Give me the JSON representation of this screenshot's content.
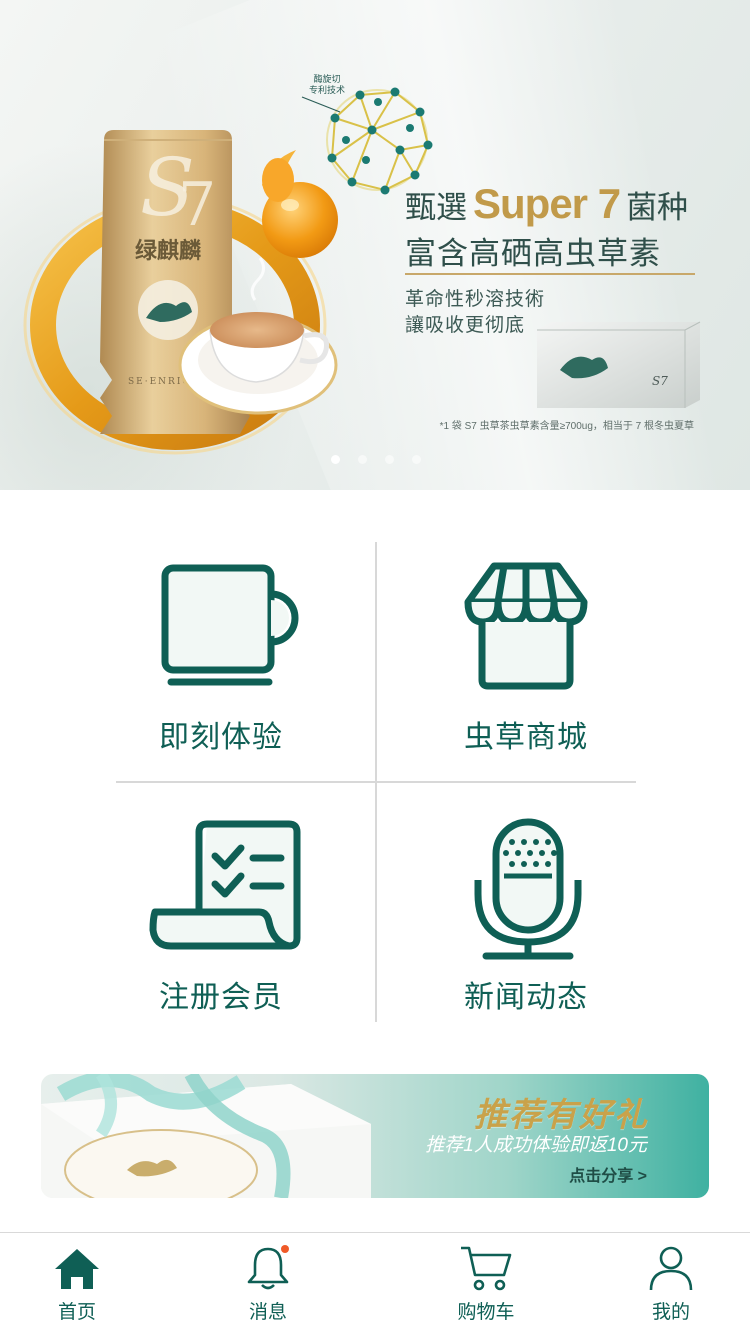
{
  "hero": {
    "brand_name": "绿麒麟",
    "brand_letters": "S7",
    "patent_lines": [
      "酶旋切",
      "专利技术"
    ],
    "headline_prefix": "甄選",
    "headline_highlight": "Super 7",
    "headline_suffix": "菌种",
    "headline_line2": "富含高硒高虫草素",
    "sub_line1": "革命性秒溶技術",
    "sub_line2": "讓吸收更彻底",
    "footnote": "*1 袋 S7 虫草茶虫草素含量≥700ug，相当于 7 根冬虫夏草",
    "slides_total": 4,
    "active_slide": 1,
    "colors": {
      "gold": "#c19a4a",
      "dark": "#2f4f4a",
      "bg": "#e9eeec"
    }
  },
  "menu": {
    "items": [
      {
        "label": "即刻体验",
        "icon": "mug-icon"
      },
      {
        "label": "虫草商城",
        "icon": "storefront-icon"
      },
      {
        "label": "注册会员",
        "icon": "checklist-icon"
      },
      {
        "label": "新闻动态",
        "icon": "microphone-icon"
      }
    ],
    "colors": {
      "accent": "#0f5f55",
      "divider": "#d8d8d8"
    }
  },
  "promo": {
    "title": "推荐有好礼",
    "subtitle": "推荐1人成功体验即返10元",
    "cta": "点击分享 >",
    "colors": {
      "gold": "#c9a24a",
      "teal": "#3fb1a1"
    }
  },
  "tabbar": {
    "tabs": [
      {
        "label": "首页",
        "icon": "home-icon",
        "active": true
      },
      {
        "label": "消息",
        "icon": "bell-icon",
        "badge": true
      },
      {
        "label": "购物车",
        "icon": "cart-icon"
      },
      {
        "label": "我的",
        "icon": "user-icon"
      }
    ],
    "colors": {
      "accent": "#0f5f55",
      "badge": "#f05a28"
    }
  }
}
